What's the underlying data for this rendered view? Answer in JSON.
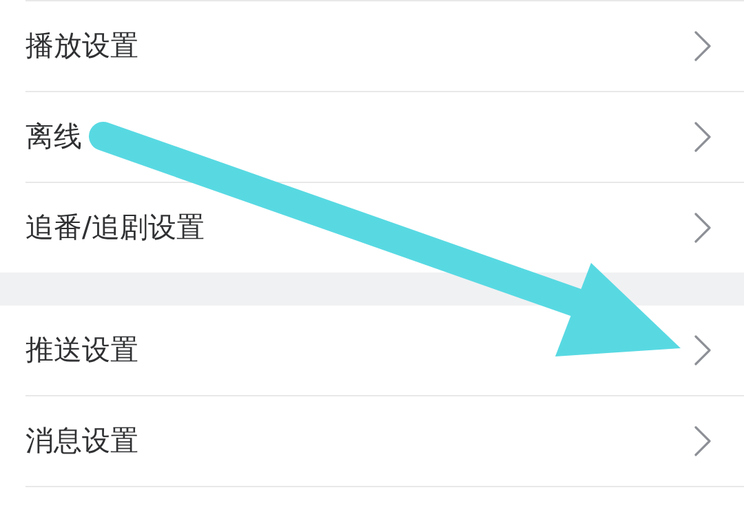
{
  "sections": [
    {
      "items": [
        {
          "label": "播放设置"
        },
        {
          "label": "离线"
        },
        {
          "label": "追番/追剧设置"
        }
      ]
    },
    {
      "items": [
        {
          "label": "推送设置"
        },
        {
          "label": "消息设置"
        }
      ]
    }
  ]
}
